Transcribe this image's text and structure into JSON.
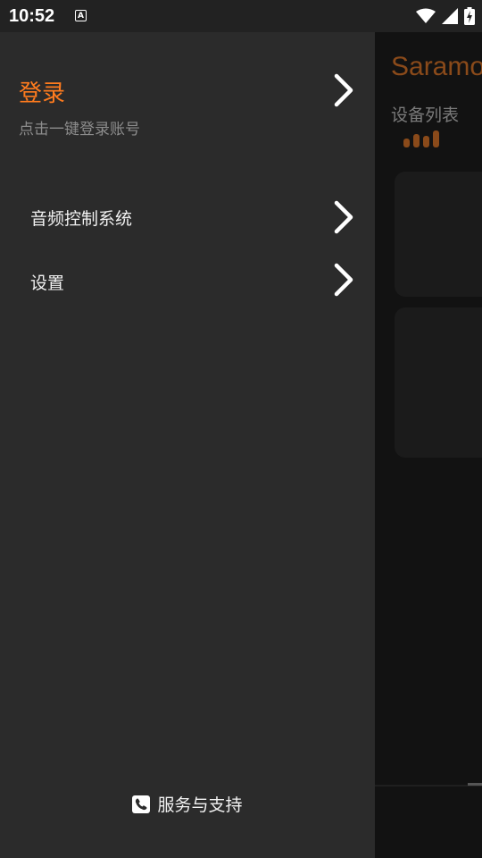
{
  "status_bar": {
    "time": "10:52",
    "notification_icon_letter": "A",
    "icons": [
      "notification-a-icon",
      "wifi-icon",
      "signal-icon",
      "battery-charging-icon"
    ]
  },
  "background_app": {
    "title": "Saramo",
    "section_label": "设备列表",
    "accent_color": "#8a4a1a"
  },
  "drawer": {
    "login": {
      "title": "登录",
      "subtitle": "点击一键登录账号"
    },
    "menu_items": [
      {
        "label": "音频控制系统",
        "icon": "chevron-right-icon"
      },
      {
        "label": "设置",
        "icon": "chevron-right-icon"
      }
    ],
    "footer": {
      "label": "服务与支持",
      "icon": "phone-icon"
    },
    "accent_color": "#ff7b1e"
  }
}
